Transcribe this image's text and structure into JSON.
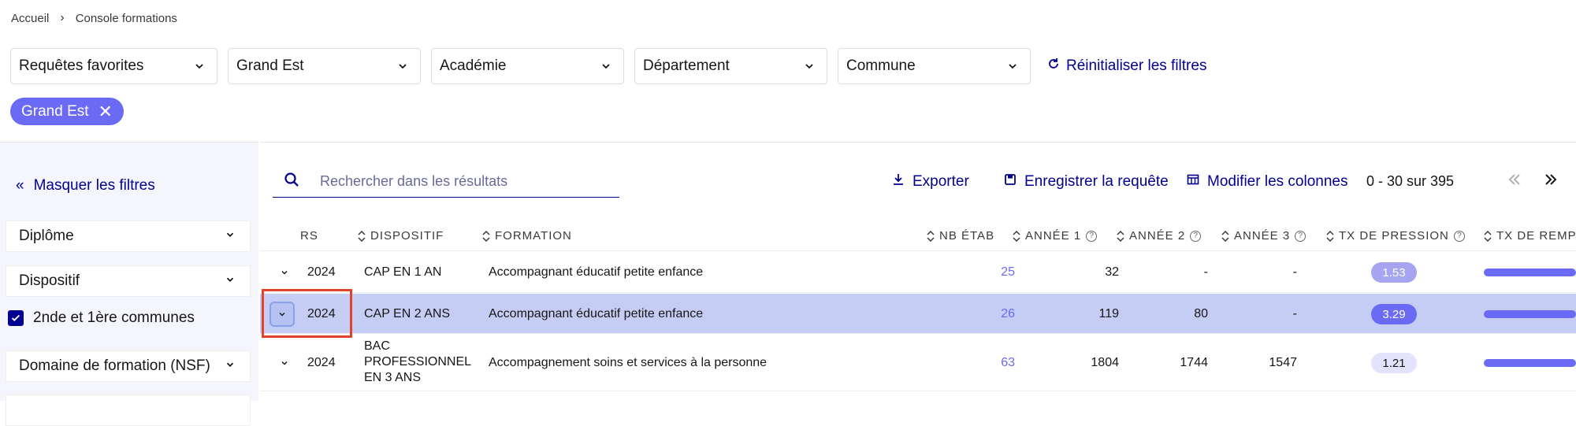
{
  "breadcrumb": {
    "home": "Accueil",
    "current": "Console formations"
  },
  "filters": {
    "favorites": "Requêtes favorites",
    "region": "Grand Est",
    "academy": "Académie",
    "department": "Département",
    "commune": "Commune",
    "reset": "Réinitialiser les filtres"
  },
  "active_tag": {
    "label": "Grand Est"
  },
  "sidebar": {
    "hide": "Masquer les filtres",
    "diploma": "Diplôme",
    "dispositif": "Dispositif",
    "common_label": "2nde et 1ère communes",
    "common_checked": true,
    "domain": "Domaine de formation (NSF)"
  },
  "toolbar": {
    "search_placeholder": "Rechercher dans les résultats",
    "export": "Exporter",
    "save": "Enregistrer la requête",
    "columns": "Modifier les colonnes",
    "pagination": "0 - 30 sur 395"
  },
  "table": {
    "headers": {
      "rs": "RS",
      "dispositif": "DISPOSITIF",
      "formation": "FORMATION",
      "nb_etab": "NB ÉTAB",
      "annee1": "ANNÉE 1",
      "annee2": "ANNÉE 2",
      "annee3": "ANNÉE 3",
      "tx_pression": "TX DE PRESSION",
      "tx_remp": "TX DE REMP"
    },
    "rows": [
      {
        "rs": "2024",
        "dispositif": "CAP EN 1 AN",
        "formation": "Accompagnant éducatif petite enfance",
        "nb_etab": "25",
        "annee1": "32",
        "annee2": "-",
        "annee3": "-",
        "tx_pression": "1.53"
      },
      {
        "rs": "2024",
        "dispositif": "CAP EN 2 ANS",
        "formation": "Accompagnant éducatif petite enfance",
        "nb_etab": "26",
        "annee1": "119",
        "annee2": "80",
        "annee3": "-",
        "tx_pression": "3.29"
      },
      {
        "rs": "2024",
        "dispositif_l1": "BAC",
        "dispositif_l2": "PROFESSIONNEL",
        "dispositif_l3": "EN 3 ANS",
        "formation": "Accompagnement soins et services à la personne",
        "nb_etab": "63",
        "annee1": "1804",
        "annee2": "1744",
        "annee3": "1547",
        "tx_pression": "1.21"
      }
    ]
  },
  "colors": {
    "accent": "#000091",
    "brand_purple": "#6a6af4",
    "selected_row": "#c5cdf5",
    "highlight": "#e1432b"
  }
}
